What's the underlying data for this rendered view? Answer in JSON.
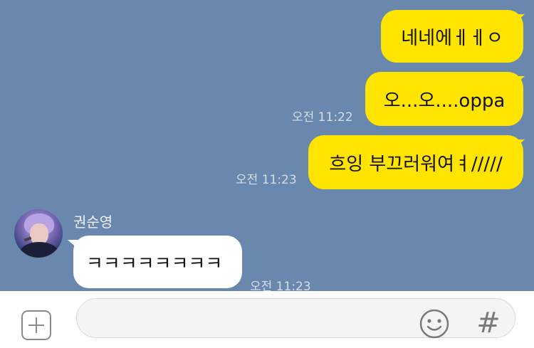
{
  "messages": [
    {
      "sender": "me",
      "text": "네네에ㅔㅔㅇ"
    },
    {
      "sender": "me",
      "text": "오...오....oppa",
      "time": "오전 11:22"
    },
    {
      "sender": "me",
      "text": "흐잉 부끄러워여ㅕ/////",
      "time": "오전 11:23"
    },
    {
      "sender": "권순영",
      "text": "ㅋㅋㅋㅋㅋㅋㅋㅋ",
      "time": "오전 11:23"
    }
  ],
  "input": {
    "placeholder": ""
  },
  "icons": {
    "plus": "plus-square-icon",
    "emoji": "smiley-icon",
    "hash": "#"
  },
  "colors": {
    "chat_background": "#6a87ae",
    "my_bubble": "#ffe400",
    "their_bubble": "#ffffff"
  }
}
